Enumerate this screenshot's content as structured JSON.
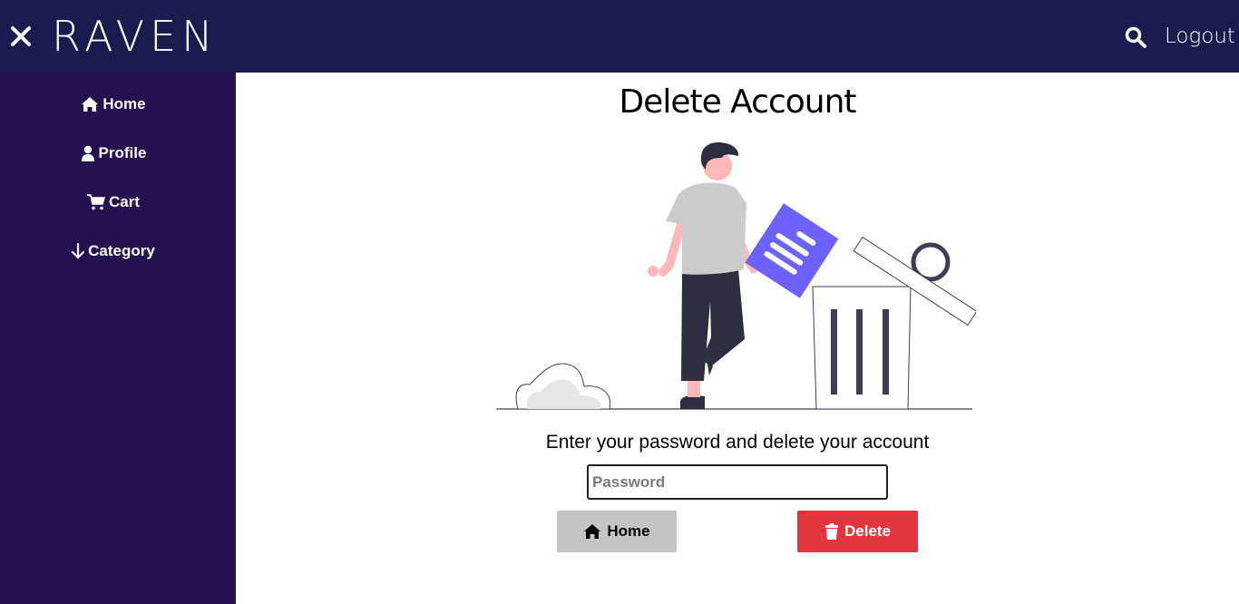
{
  "header": {
    "brand": "RAVEN",
    "logout_label": "Logout",
    "icons": {
      "close": "close-icon",
      "search": "search-icon"
    }
  },
  "sidebar": {
    "items": [
      {
        "label": "Home",
        "icon": "home-icon"
      },
      {
        "label": "Profile",
        "icon": "user-icon"
      },
      {
        "label": "Cart",
        "icon": "cart-icon"
      },
      {
        "label": "Category",
        "icon": "arrow-down-icon"
      }
    ]
  },
  "main": {
    "title": "Delete Account",
    "prompt": "Enter your password and delete your account",
    "password": {
      "value": "",
      "placeholder": "Password"
    },
    "home_button": {
      "label": "Home",
      "icon": "home-icon"
    },
    "delete_button": {
      "label": "Delete",
      "icon": "trash-icon"
    }
  },
  "colors": {
    "topbar": "#1c1b4f",
    "sidebar": "#261150",
    "delete": "#e5363d",
    "home_button": "#c4c4c4",
    "illustration_accent": "#6c63ff"
  }
}
